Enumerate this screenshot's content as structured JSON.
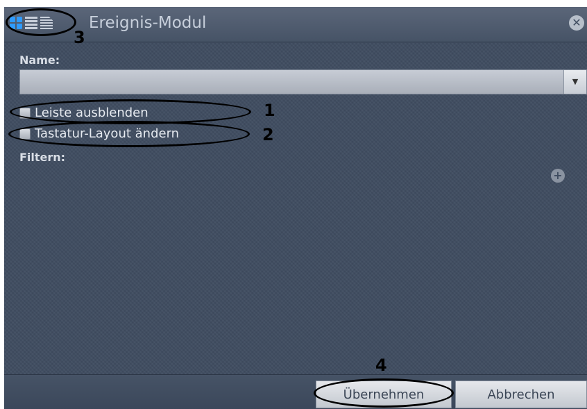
{
  "window": {
    "title": "Ereignis-Modul",
    "close_icon": "close-icon"
  },
  "view_icons": [
    "grid-view-icon",
    "list-view-icon",
    "lines-view-icon"
  ],
  "name": {
    "label": "Name:",
    "value": ""
  },
  "checkboxes": [
    {
      "label": "Leiste ausblenden",
      "checked": false
    },
    {
      "label": "Tastatur-Layout ändern",
      "checked": false
    }
  ],
  "filter": {
    "label": "Filtern:"
  },
  "buttons": {
    "apply": "Übernehmen",
    "cancel": "Abbrechen"
  },
  "annotations": [
    "1",
    "2",
    "3",
    "4"
  ],
  "colors": {
    "accent": "#2f9bff",
    "panel": "#3f4c60"
  }
}
